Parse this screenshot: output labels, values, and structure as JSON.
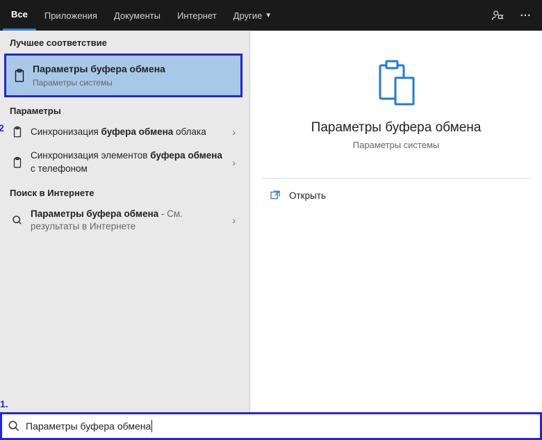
{
  "tabs": {
    "items": [
      "Все",
      "Приложения",
      "Документы",
      "Интернет",
      "Другие"
    ],
    "active_index": 0,
    "more_has_chevron": true
  },
  "sections": {
    "best_match": "Лучшее соответствие",
    "params": "Параметры",
    "web": "Поиск в Интернете"
  },
  "best": {
    "title": "Параметры буфера обмена",
    "sub": "Параметры системы"
  },
  "results_params": [
    {
      "plain1": "Синхронизация ",
      "bold": "буфера обмена",
      "plain2": " облака"
    },
    {
      "plain1": "Синхронизация элементов ",
      "bold": "буфера обмена",
      "plain2": " с телефоном"
    }
  ],
  "results_web": [
    {
      "bold": "Параметры буфера обмена",
      "suffix": " - См. результаты в Интернете"
    }
  ],
  "preview": {
    "title": "Параметры буфера обмена",
    "sub": "Параметры системы",
    "open": "Открыть"
  },
  "search": {
    "value": "Параметры буфера обмена"
  },
  "annotations": {
    "one": "1.",
    "two": "2"
  }
}
